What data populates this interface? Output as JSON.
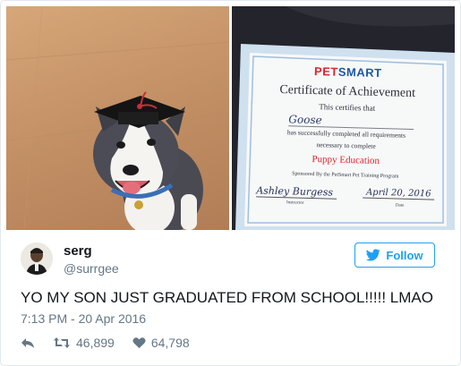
{
  "tweet": {
    "images": [
      {
        "name": "puppy-photo",
        "description_icon": "dog-graduation-cap-photo"
      },
      {
        "name": "certificate-photo",
        "description_icon": "certificate-document-photo"
      }
    ],
    "certificate": {
      "brand_pet": "PET",
      "brand_smart": "SMART",
      "title": "Certificate of Achievement",
      "certifies": "This certifies that",
      "recipient": "Goose",
      "line1": "has successfully completed all requirements",
      "line2": "necessary to complete",
      "program": "Puppy Education",
      "sponsor": "Sponsored By the PetSmart Pet Training Program",
      "signature": "Ashley Burgess",
      "signature_label": "Instructor",
      "date": "April 20, 2016",
      "date_label": "Date"
    },
    "author": {
      "display_name": "serg",
      "handle": "@surrgee",
      "avatar_icon": "user-avatar"
    },
    "follow_label": "Follow",
    "text": "YO MY SON JUST GRADUATED FROM SCHOOL!!!!! LMAO",
    "timestamp": "7:13 PM - 20 Apr 2016",
    "actions": {
      "reply_icon": "reply-icon",
      "retweet_icon": "retweet-icon",
      "retweet_count": "46,899",
      "like_icon": "heart-icon",
      "like_count": "64,798"
    },
    "colors": {
      "accent": "#1da1f2",
      "text": "#14171a",
      "muted": "#657786",
      "border": "#e1e8ed",
      "petsmart_red": "#d6262f"
    }
  }
}
